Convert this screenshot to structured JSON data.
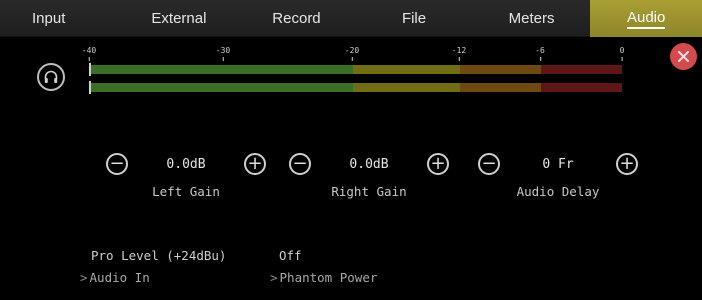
{
  "tabs": [
    {
      "label": "Input"
    },
    {
      "label": "External"
    },
    {
      "label": "Record"
    },
    {
      "label": "File"
    },
    {
      "label": "Meters"
    },
    {
      "label": "Audio"
    }
  ],
  "active_tab": "Audio",
  "meter": {
    "scale": [
      "-40",
      "-30",
      "-20",
      "-12",
      "-6",
      "0"
    ],
    "left_peak": "-40",
    "right_peak": "-40"
  },
  "controls": {
    "left_gain": {
      "value": "0.0dB",
      "label": "Left Gain",
      "dec": "−",
      "inc": "+"
    },
    "right_gain": {
      "value": "0.0dB",
      "label": "Right Gain",
      "dec": "−",
      "inc": "+"
    },
    "audio_delay": {
      "value": "0 Fr",
      "label": "Audio Delay",
      "dec": "−",
      "inc": "+"
    }
  },
  "settings": {
    "audio_in": {
      "value": "Pro Level (+24dBu)",
      "label": "Audio In",
      "chevron": ">"
    },
    "phantom_power": {
      "value": "Off",
      "label": "Phantom Power",
      "chevron": ">"
    }
  },
  "colors": {
    "accent": "#9a922e",
    "close": "#d44b4f",
    "meter_green": "#3c6f25",
    "meter_yellow": "#716d14",
    "meter_orange": "#6e4a13",
    "meter_red": "#5e1717"
  }
}
